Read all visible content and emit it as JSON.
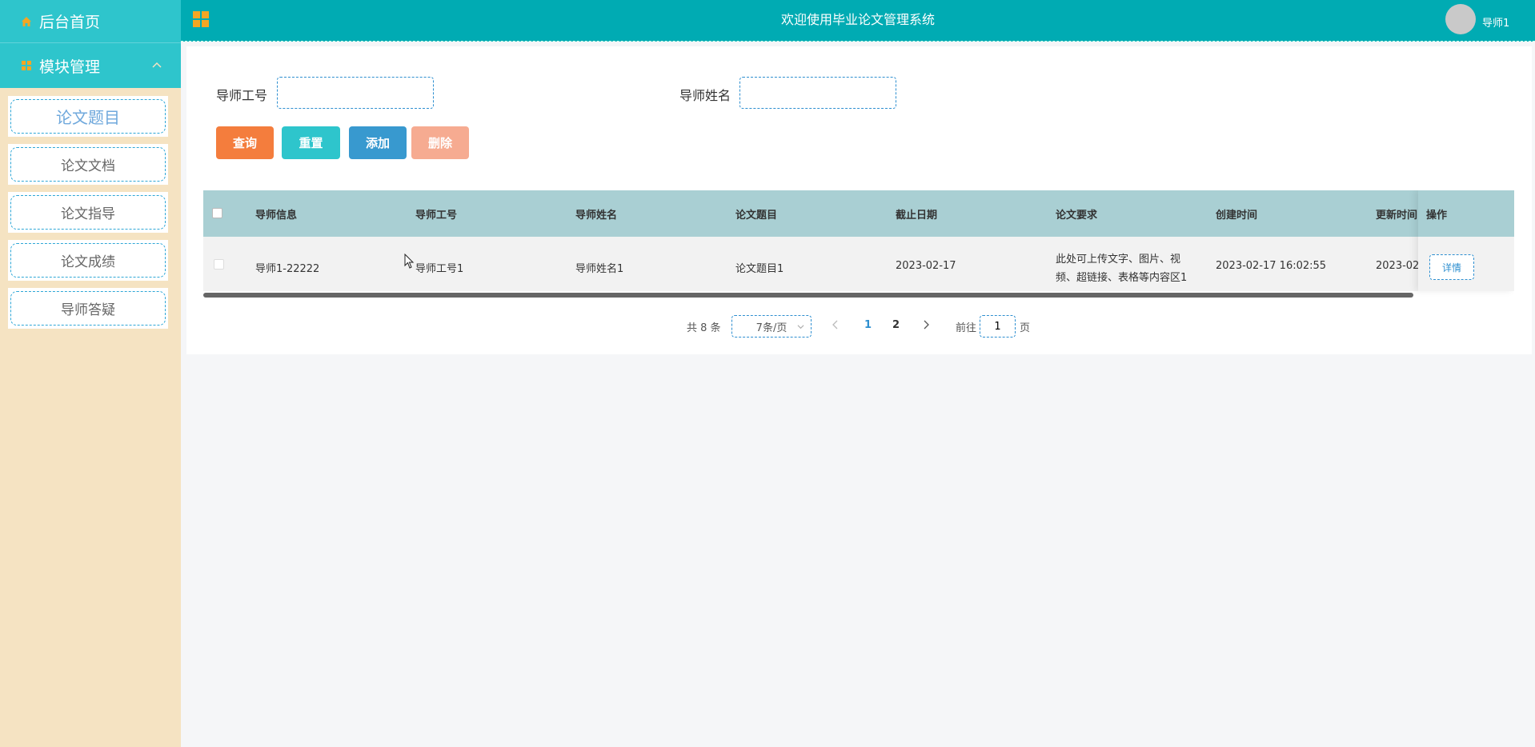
{
  "sidebar": {
    "home_label": "后台首页",
    "module_label": "模块管理",
    "items": [
      {
        "label": "论文题目",
        "active": true
      },
      {
        "label": "论文文档",
        "active": false
      },
      {
        "label": "论文指导",
        "active": false
      },
      {
        "label": "论文成绩",
        "active": false
      },
      {
        "label": "导师答疑",
        "active": false
      }
    ]
  },
  "header": {
    "title": "欢迎使用毕业论文管理系统",
    "username": "导师1"
  },
  "search": {
    "teacher_id_label": "导师工号",
    "teacher_id_value": "",
    "teacher_name_label": "导师姓名",
    "teacher_name_value": ""
  },
  "actions": {
    "query": "查询",
    "reset": "重置",
    "add": "添加",
    "delete": "删除"
  },
  "table": {
    "columns": [
      "导师信息",
      "导师工号",
      "导师姓名",
      "论文题目",
      "截止日期",
      "论文要求",
      "创建时间",
      "更新时间",
      "操作"
    ],
    "rows": [
      {
        "info": "导师1-22222",
        "teacher_id": "导师工号1",
        "teacher_name": "导师姓名1",
        "topic": "论文题目1",
        "deadline": "2023-02-17",
        "req_line1": "此处可上传文字、图片、视",
        "req_line2": "频、超链接、表格等内容区1",
        "created": "2023-02-17 16:02:55",
        "updated": "2023-02-",
        "detail_label": "详情"
      }
    ]
  },
  "pagination": {
    "total_text": "共 8 条",
    "page_size": "7条/页",
    "pages": [
      "1",
      "2"
    ],
    "current_page": "1",
    "goto_label": "前往",
    "goto_value": "1",
    "page_unit": "页"
  },
  "colors": {
    "header": "#00abb3",
    "sidebar_top": "#2ec5cc",
    "sidebar_bg": "#f5e3c2",
    "query": "#f47d3d",
    "reset": "#2ec5cc",
    "add": "#3899cf",
    "delete": "#f6ab91",
    "table_header": "#a9cfd3"
  }
}
